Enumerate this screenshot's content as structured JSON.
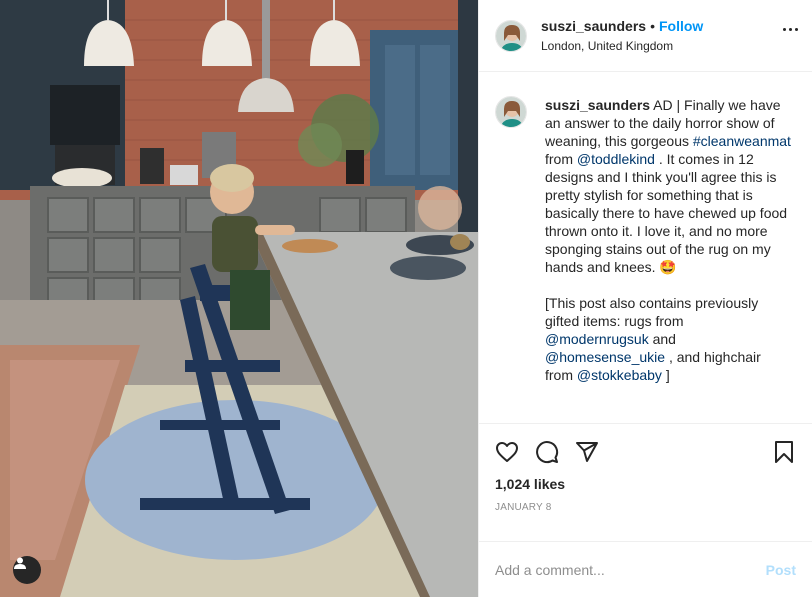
{
  "post": {
    "username": "suszi_saunders",
    "dot": "•",
    "follow_label": "Follow",
    "location": "London, United Kingdom"
  },
  "caption": {
    "username": "suszi_saunders",
    "t1": " AD | Finally we have an answer to the daily horror show of weaning, this gorgeous ",
    "hashtag": "#cleanweanmat",
    "t2": " from ",
    "m1": "@toddlekind",
    "t3": " . It comes in 12 designs and I think you'll agree this is pretty stylish for something that is basically there to have chewed up food thrown onto it. I love it, and no more sponging stains out of the rug on my hands and knees. 🤩",
    "p2a": "[This post also contains previously gifted items: rugs from ",
    "m2": "@modernrugsuk",
    "p2b": " and ",
    "m3": "@homesense_ukie",
    "p2c": " , and highchair from ",
    "m4": "@stokkebaby",
    "p2d": " ]"
  },
  "engagement": {
    "likes": "1,024 likes",
    "date": "JANUARY 8"
  },
  "comment_box": {
    "placeholder": "Add a comment...",
    "post_label": "Post"
  },
  "icons": {
    "like": "heart-icon",
    "comment": "comment-icon",
    "share": "share-icon",
    "save": "bookmark-icon",
    "tag": "user-tag-icon",
    "more": "more-options-icon"
  },
  "colors": {
    "follow": "#0095f6",
    "link": "#00376b",
    "muted": "#8e8e8e",
    "post_disabled": "#b2dffc"
  }
}
